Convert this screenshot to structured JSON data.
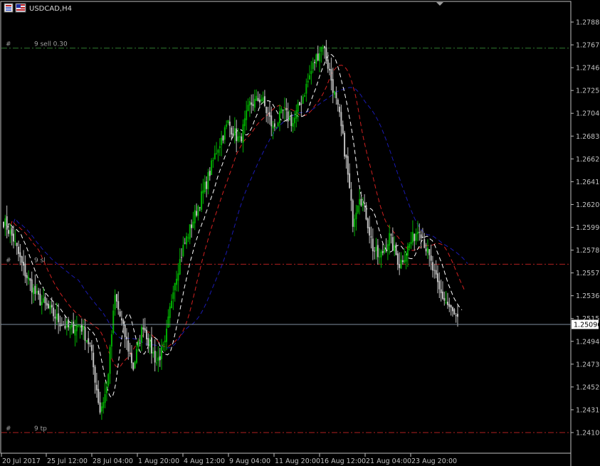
{
  "window": {
    "title": "USDCAD,H4",
    "icons": [
      "chart-window-icon",
      "symbol-flag-icon"
    ]
  },
  "colors": {
    "background": "#000000",
    "frame": "#c0c0c0",
    "bull_candle": "#00b000",
    "bear_candle": "#c0c0c0",
    "ma_fast": "#ffffff",
    "ma_mid": "#d02020",
    "ma_slow": "#1a1ab0",
    "sell_line": "#2f7a2f",
    "level_line": "#b02020",
    "current_price_line": "#8090a0"
  },
  "chart_data": {
    "type": "candlestick",
    "symbol": "USDCAD",
    "timeframe": "H4",
    "price_axis": {
      "ticks": [
        "1.27880",
        "1.27670",
        "1.27460",
        "1.27250",
        "1.27040",
        "1.26830",
        "1.26620",
        "1.26410",
        "1.26200",
        "1.25990",
        "1.25780",
        "1.25570",
        "1.25360",
        "1.25150",
        "1.24940",
        "1.24730",
        "1.24520",
        "1.24310",
        "1.24100"
      ],
      "range": [
        1.2402,
        1.2795
      ]
    },
    "time_axis": {
      "labels": [
        "20 Jul 2017",
        "25 Jul 12:00",
        "28 Jul 04:00",
        "1 Aug 20:00",
        "4 Aug 12:00",
        "9 Aug 04:00",
        "11 Aug 20:00",
        "16 Aug 12:00",
        "21 Aug 04:00",
        "23 Aug 20:00"
      ]
    },
    "current_price": "1.25096",
    "trade_lines": [
      {
        "marker": "#",
        "label": "9 sell 0.30",
        "price": 1.2764,
        "kind": "sell"
      },
      {
        "marker": "#",
        "label": "9 sl",
        "price": 1.2565,
        "kind": "level"
      },
      {
        "marker": "#",
        "label": "9 tp",
        "price": 1.241,
        "kind": "level"
      }
    ],
    "close_path": [
      [
        0,
        1.2605
      ],
      [
        6,
        1.2588
      ],
      [
        12,
        1.256
      ],
      [
        20,
        1.2535
      ],
      [
        28,
        1.2522
      ],
      [
        34,
        1.2512
      ],
      [
        40,
        1.2505
      ],
      [
        46,
        1.251
      ],
      [
        52,
        1.249
      ],
      [
        58,
        1.243
      ],
      [
        62,
        1.245
      ],
      [
        67,
        1.2535
      ],
      [
        72,
        1.2505
      ],
      [
        78,
        1.247
      ],
      [
        84,
        1.251
      ],
      [
        88,
        1.249
      ],
      [
        92,
        1.2475
      ],
      [
        97,
        1.249
      ],
      [
        102,
        1.2545
      ],
      [
        108,
        1.258
      ],
      [
        115,
        1.261
      ],
      [
        122,
        1.264
      ],
      [
        128,
        1.267
      ],
      [
        135,
        1.2695
      ],
      [
        142,
        1.2678
      ],
      [
        148,
        1.2712
      ],
      [
        155,
        1.2718
      ],
      [
        162,
        1.269
      ],
      [
        168,
        1.2705
      ],
      [
        174,
        1.2695
      ],
      [
        180,
        1.272
      ],
      [
        187,
        1.2752
      ],
      [
        192,
        1.2768
      ],
      [
        197,
        1.2735
      ],
      [
        202,
        1.27
      ],
      [
        206,
        1.266
      ],
      [
        210,
        1.2605
      ],
      [
        214,
        1.263
      ],
      [
        218,
        1.261
      ],
      [
        222,
        1.258
      ],
      [
        226,
        1.257
      ],
      [
        232,
        1.259
      ],
      [
        238,
        1.2565
      ],
      [
        244,
        1.2583
      ],
      [
        250,
        1.26
      ],
      [
        256,
        1.257
      ],
      [
        262,
        1.254
      ],
      [
        268,
        1.2525
      ],
      [
        273,
        1.2512
      ]
    ],
    "candle_count": 274
  }
}
